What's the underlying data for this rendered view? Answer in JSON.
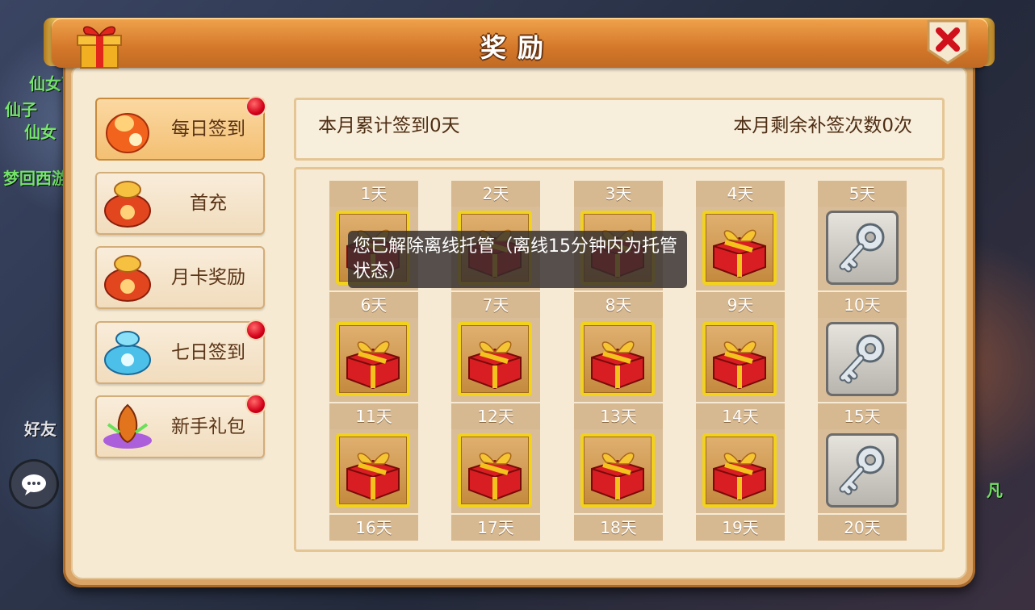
{
  "window": {
    "title": "奖励"
  },
  "sidebar": {
    "items": [
      {
        "label": "每日签到",
        "icon": "red-pouch-icon",
        "active": true,
        "badge": true
      },
      {
        "label": "首充",
        "icon": "treasure-bag-icon",
        "active": false,
        "badge": false
      },
      {
        "label": "月卡奖励",
        "icon": "treasure-bag-icon",
        "active": false,
        "badge": false
      },
      {
        "label": "七日签到",
        "icon": "blue-pouch-icon",
        "active": false,
        "badge": true
      },
      {
        "label": "新手礼包",
        "icon": "magic-orb-icon",
        "active": false,
        "badge": true
      }
    ]
  },
  "summary": {
    "signed_days": "本月累计签到0天",
    "remaining_makeup": "本月剩余补签次数0次"
  },
  "calendar": {
    "days": [
      {
        "label": "1天",
        "reward": "gift-box-icon"
      },
      {
        "label": "2天",
        "reward": "gift-box-icon"
      },
      {
        "label": "3天",
        "reward": "gift-box-icon"
      },
      {
        "label": "4天",
        "reward": "gift-box-icon"
      },
      {
        "label": "5天",
        "reward": "key-icon"
      },
      {
        "label": "6天",
        "reward": "gift-box-icon"
      },
      {
        "label": "7天",
        "reward": "gift-box-icon"
      },
      {
        "label": "8天",
        "reward": "gift-box-icon"
      },
      {
        "label": "9天",
        "reward": "gift-box-icon"
      },
      {
        "label": "10天",
        "reward": "key-icon"
      },
      {
        "label": "11天",
        "reward": "gift-box-icon"
      },
      {
        "label": "12天",
        "reward": "gift-box-icon"
      },
      {
        "label": "13天",
        "reward": "gift-box-icon"
      },
      {
        "label": "14天",
        "reward": "gift-box-icon"
      },
      {
        "label": "15天",
        "reward": "key-icon"
      },
      {
        "label": "16天",
        "reward": ""
      },
      {
        "label": "17天",
        "reward": ""
      },
      {
        "label": "18天",
        "reward": ""
      },
      {
        "label": "19天",
        "reward": ""
      },
      {
        "label": "20天",
        "reward": ""
      }
    ]
  },
  "toast": {
    "message": "您已解除离线托管（离线15分钟内为托管状态）"
  },
  "background": {
    "texts": [
      "仙女下",
      "仙子",
      "仙女",
      "凡",
      "梦回西游",
      "好友"
    ]
  },
  "colors": {
    "title_bar": "#d4782a",
    "panel": "#f6ead3",
    "gold_frame": "#f3d21c",
    "badge_red": "#d4001a"
  }
}
